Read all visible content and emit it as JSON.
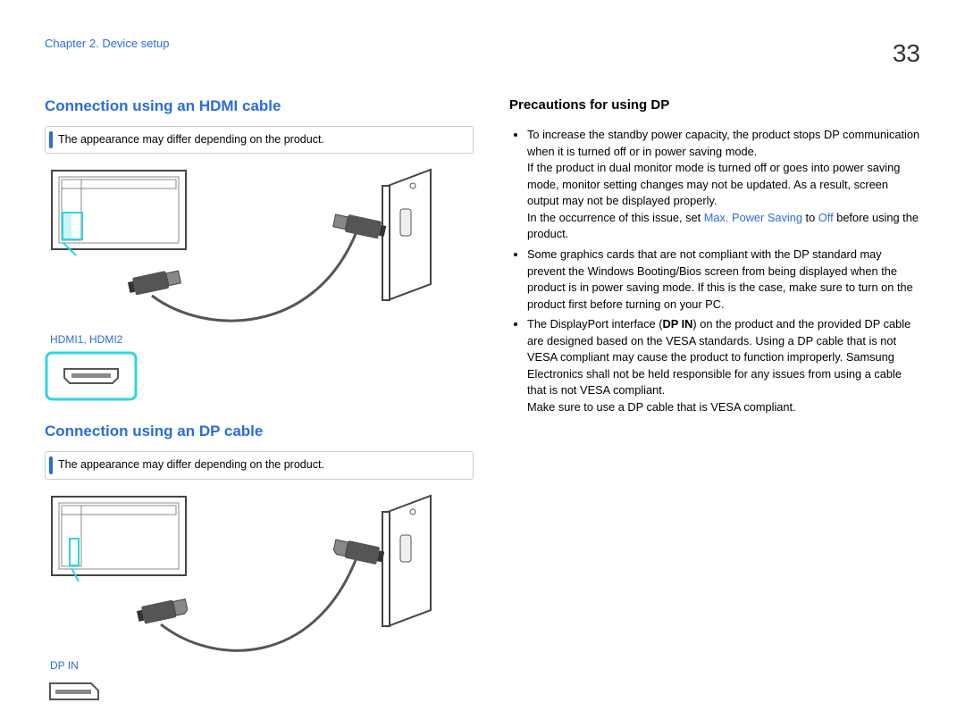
{
  "page": {
    "chapter": "Chapter 2. Device setup",
    "number": "33"
  },
  "left": {
    "hdmi": {
      "title": "Connection using an HDMI cable",
      "note": "The appearance may differ depending on the product.",
      "port_label": "HDMI1, HDMI2"
    },
    "dp": {
      "title": "Connection using an DP cable",
      "note": "The appearance may differ depending on the product.",
      "port_label": "DP IN"
    }
  },
  "right": {
    "title": "Precautions for using DP",
    "bullets": [
      {
        "pre": "To increase the standby power capacity, the product stops DP communication when it is turned off or in power saving mode.",
        "line2": "If the product in dual monitor mode is turned off or goes into power saving mode, monitor setting changes may not be updated. As a result, screen output may not be displayed properly.",
        "line3a": "In the occurrence of this issue, set ",
        "line3_accent1": "Max. Power Saving",
        "line3b": " to ",
        "line3_accent2": "Off",
        "line3c": " before using the product."
      },
      {
        "text": "Some graphics cards that are not compliant with the DP standard may prevent the Windows Booting/Bios screen from being displayed when the product is in power saving mode. If this is the case, make sure to turn on the product first before turning on your PC."
      },
      {
        "preA": "The DisplayPort interface (",
        "bold": "DP IN",
        "preB": ") on the product and the provided DP cable are designed based on the VESA standards. Using a DP cable that is not VESA compliant may cause the product to function improperly. Samsung Electronics shall not be held responsible for any issues from using a cable that is not VESA compliant.",
        "line2": "Make sure to use a DP cable that is VESA compliant."
      }
    ]
  }
}
